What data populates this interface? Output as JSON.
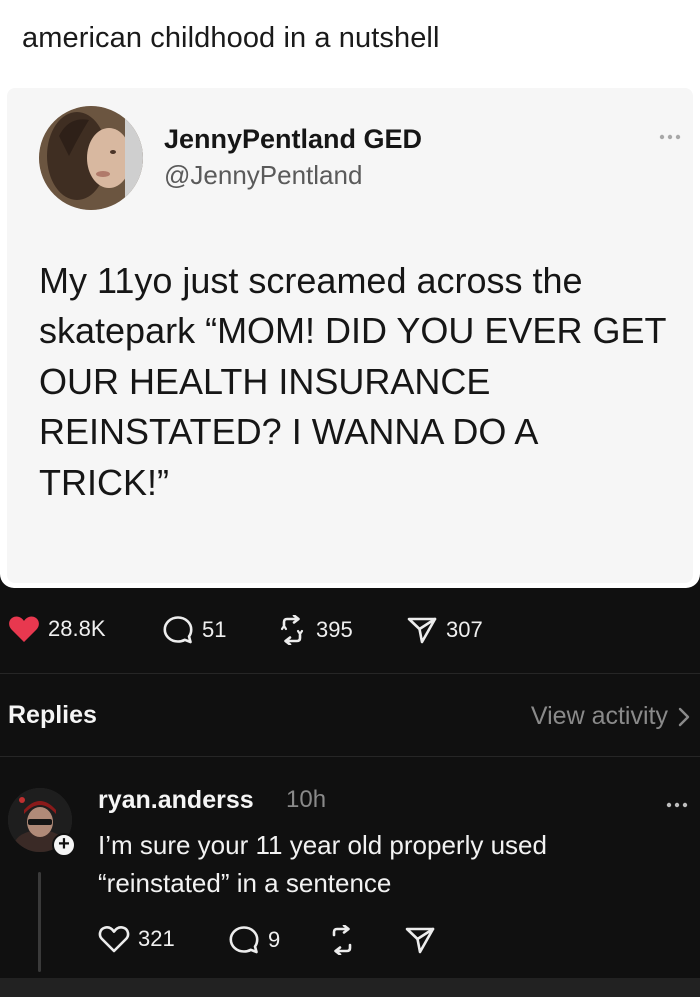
{
  "caption": "american childhood in a nutshell",
  "tweet": {
    "display_name": "JennyPentland GED",
    "handle": "@JennyPentland",
    "more_icon": "ellipsis-icon",
    "text": "My 11yo just screamed across the skatepark “MOM! DID YOU EVER GET OUR HEALTH INSURANCE REINSTATED? I WANNA DO A TRICK!”"
  },
  "post_actions": {
    "likes": "28.8K",
    "comments": "51",
    "reposts": "395",
    "shares": "307",
    "liked": true,
    "like_color": "#e8384f"
  },
  "replies_section": {
    "label": "Replies",
    "view_activity": "View activity"
  },
  "reply": {
    "username": "ryan.anderss",
    "time": "10h",
    "text": "I’m sure your 11 year old properly used “reinstated” in a sentence",
    "likes": "321",
    "comments": "9"
  }
}
